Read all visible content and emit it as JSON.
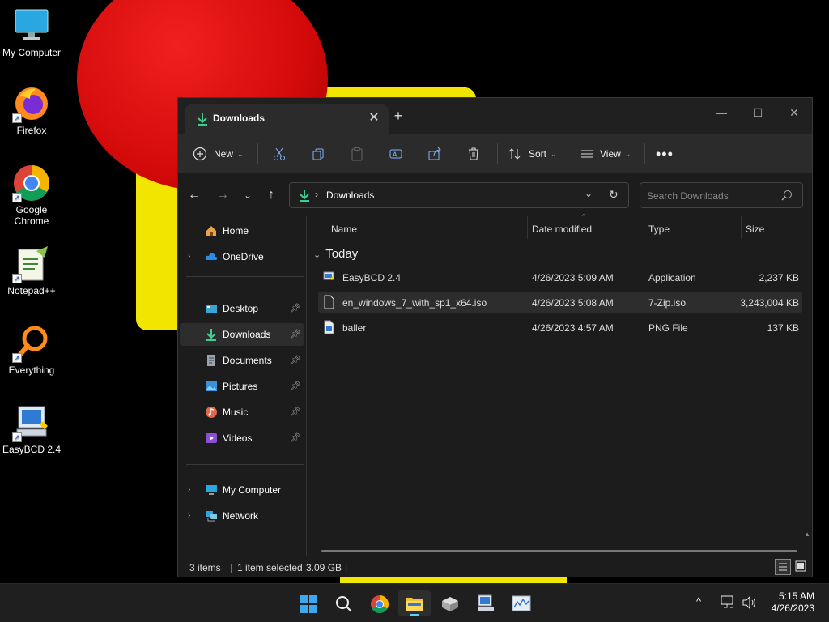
{
  "desktop": {
    "icons": [
      {
        "label": "My Computer",
        "icon": "monitor-icon"
      },
      {
        "label": "Firefox",
        "icon": "firefox-icon"
      },
      {
        "label": "Google\nChrome",
        "icon": "chrome-icon"
      },
      {
        "label": "Notepad++",
        "icon": "notepadpp-icon"
      },
      {
        "label": "Everything",
        "icon": "everything-icon"
      },
      {
        "label": "EasyBCD 2.4",
        "icon": "easybcd-icon"
      }
    ]
  },
  "window": {
    "tab_title": "Downloads",
    "commands": {
      "new_label": "New",
      "sort_label": "Sort",
      "view_label": "View"
    },
    "address": {
      "crumb": "Downloads",
      "search_placeholder": "Search Downloads"
    },
    "sidebar": {
      "items": [
        {
          "label": "Home",
          "icon": "home-icon",
          "pinned": false
        },
        {
          "label": "OneDrive",
          "icon": "onedrive-icon",
          "pinned": false
        },
        {
          "label": "Desktop",
          "icon": "desktop-folder-icon",
          "pinned": true
        },
        {
          "label": "Downloads",
          "icon": "downloads-folder-icon",
          "pinned": true
        },
        {
          "label": "Documents",
          "icon": "documents-folder-icon",
          "pinned": true
        },
        {
          "label": "Pictures",
          "icon": "pictures-folder-icon",
          "pinned": true
        },
        {
          "label": "Music",
          "icon": "music-folder-icon",
          "pinned": true
        },
        {
          "label": "Videos",
          "icon": "videos-folder-icon",
          "pinned": true
        },
        {
          "label": "My Computer",
          "icon": "computer-icon",
          "pinned": false
        },
        {
          "label": "Network",
          "icon": "network-icon",
          "pinned": false
        }
      ]
    },
    "columns": {
      "name": "Name",
      "date": "Date modified",
      "type": "Type",
      "size": "Size"
    },
    "group_label": "Today",
    "files": [
      {
        "name": "EasyBCD 2.4",
        "date": "4/26/2023 5:09 AM",
        "type": "Application",
        "size": "2,237 KB",
        "icon": "application-icon"
      },
      {
        "name": "en_windows_7_with_sp1_x64.iso",
        "date": "4/26/2023 5:08 AM",
        "type": "7-Zip.iso",
        "size": "3,243,004 KB",
        "icon": "file-icon"
      },
      {
        "name": "baller",
        "date": "4/26/2023 4:57 AM",
        "type": "PNG File",
        "size": "137 KB",
        "icon": "image-file-icon"
      }
    ],
    "status": {
      "items_count": "3 items",
      "selected": "1 item selected",
      "selected_size": "3.09 GB"
    }
  },
  "taskbar": {
    "time": "5:15 AM",
    "date": "4/26/2023"
  }
}
